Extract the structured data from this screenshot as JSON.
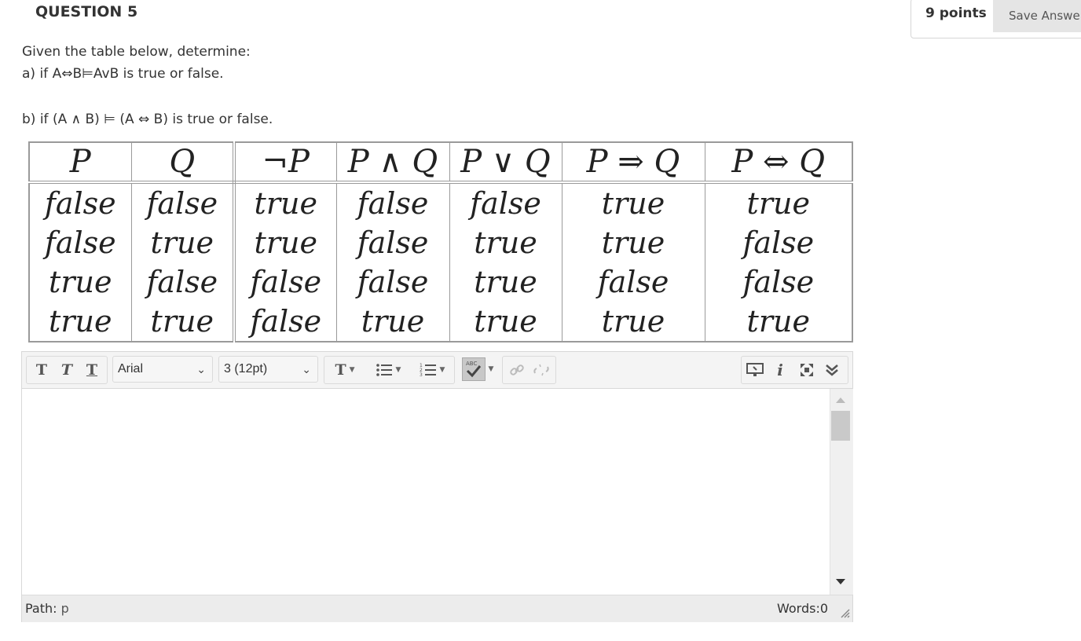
{
  "question": {
    "title": "QUESTION 5",
    "points": "9 points",
    "save_label": "Save Answer"
  },
  "prompt": {
    "line1": "Given the table below,  determine:",
    "line2": "a) if  A⇔B⊨AvB is true or false.",
    "line3": "b)  if  (A ∧ B) ⊨ (A ⇔ B) is true or false."
  },
  "truth_table": {
    "headers": [
      "P",
      "Q",
      "¬P",
      "P ∧ Q",
      "P ∨ Q",
      "P ⇒ Q",
      "P ⇔ Q"
    ],
    "rows": [
      [
        "false",
        "false",
        "true",
        "false",
        "false",
        "true",
        "true"
      ],
      [
        "false",
        "true",
        "true",
        "false",
        "true",
        "true",
        "false"
      ],
      [
        "true",
        "false",
        "false",
        "false",
        "true",
        "false",
        "false"
      ],
      [
        "true",
        "true",
        "false",
        "true",
        "true",
        "true",
        "true"
      ]
    ]
  },
  "editor": {
    "font_family": "Arial",
    "font_size": "3 (12pt)",
    "path_label": "Path:",
    "path_value": "p",
    "words": "Words:0"
  },
  "icons": {
    "bold": "bold-text-icon",
    "italic": "italic-text-icon",
    "underline": "underline-text-icon",
    "text_color": "text-color-icon",
    "bullets": "bulleted-list-icon",
    "numbers": "numbered-list-icon",
    "spellcheck": "spellcheck-icon",
    "link": "link-icon",
    "unlink": "unlink-icon",
    "preview": "preview-icon",
    "info": "info-icon",
    "fullscreen": "fullscreen-icon",
    "collapse": "collapse-toolbar-icon"
  }
}
